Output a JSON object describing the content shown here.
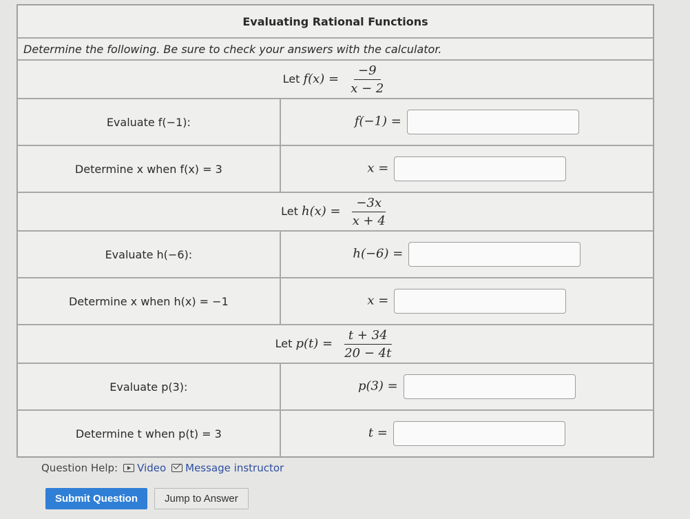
{
  "title": "Evaluating Rational Functions",
  "instructions": "Determine the following. Be sure to check your answers with the calculator.",
  "sections": [
    {
      "definition": {
        "prefix": "Let",
        "lhs": "f(x) =",
        "numerator": "−9",
        "denominator": "x − 2"
      },
      "rows": [
        {
          "prompt": "Evaluate f(−1):",
          "answer_label": "f(−1) =",
          "answer_value": ""
        },
        {
          "prompt": "Determine x when f(x) = 3",
          "answer_label": "x =",
          "answer_value": ""
        }
      ]
    },
    {
      "definition": {
        "prefix": "Let",
        "lhs": "h(x) =",
        "numerator": "−3x",
        "denominator": "x + 4"
      },
      "rows": [
        {
          "prompt": "Evaluate h(−6):",
          "answer_label": "h(−6) =",
          "answer_value": ""
        },
        {
          "prompt": "Determine x when h(x) = −1",
          "answer_label": "x =",
          "answer_value": ""
        }
      ]
    },
    {
      "definition": {
        "prefix": "Let",
        "lhs": "p(t) =",
        "numerator": "t + 34",
        "denominator": "20 − 4t"
      },
      "rows": [
        {
          "prompt": "Evaluate p(3):",
          "answer_label": "p(3) =",
          "answer_value": ""
        },
        {
          "prompt": "Determine t when p(t) = 3",
          "answer_label": "t =",
          "answer_value": ""
        }
      ]
    }
  ],
  "help": {
    "label": "Question Help:",
    "video": "Video",
    "message": "Message instructor"
  },
  "buttons": {
    "submit": "Submit Question",
    "jump": "Jump to Answer"
  }
}
